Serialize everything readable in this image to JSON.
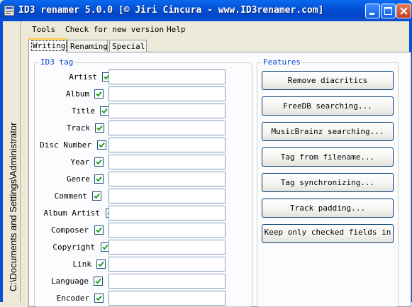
{
  "window": {
    "title": "ID3 renamer 5.0.0 [© Jiri Cincura - www.ID3renamer.com]",
    "title_color": "#ffffff",
    "titlebar_color": "#0a54d8"
  },
  "sidebar": {
    "path": "C:\\Documents and Settings\\Administrator"
  },
  "menu": {
    "items": [
      "Tools",
      "Check for new version",
      "Help"
    ]
  },
  "tabs": [
    {
      "label": "Writing",
      "active": true
    },
    {
      "label": "Renaming",
      "active": false
    },
    {
      "label": "Special",
      "active": false
    }
  ],
  "id3_group": {
    "legend": "ID3 tag",
    "fields": [
      {
        "label": "Artist",
        "checked": true,
        "value": ""
      },
      {
        "label": "Album",
        "checked": true,
        "value": ""
      },
      {
        "label": "Title",
        "checked": true,
        "value": ""
      },
      {
        "label": "Track",
        "checked": true,
        "value": ""
      },
      {
        "label": "Disc Number",
        "checked": true,
        "value": ""
      },
      {
        "label": "Year",
        "checked": true,
        "value": ""
      },
      {
        "label": "Genre",
        "checked": true,
        "value": ""
      },
      {
        "label": "Comment",
        "checked": true,
        "value": ""
      },
      {
        "label": "Album Artist",
        "checked": true,
        "value": ""
      },
      {
        "label": "Composer",
        "checked": true,
        "value": ""
      },
      {
        "label": "Copyright",
        "checked": true,
        "value": ""
      },
      {
        "label": "Link",
        "checked": true,
        "value": ""
      },
      {
        "label": "Language",
        "checked": true,
        "value": ""
      },
      {
        "label": "Encoder",
        "checked": true,
        "value": ""
      }
    ]
  },
  "features_group": {
    "legend": "Features",
    "buttons": [
      "Remove diacritics",
      "FreeDB searching...",
      "MusicBrainz searching...",
      "Tag from filename...",
      "Tag synchronizing...",
      "Track padding...",
      "Keep only checked fields in"
    ]
  },
  "colors": {
    "legend": "#0046d5",
    "checkmark": "#21a121",
    "tab_highlight": "#ffc83c"
  }
}
